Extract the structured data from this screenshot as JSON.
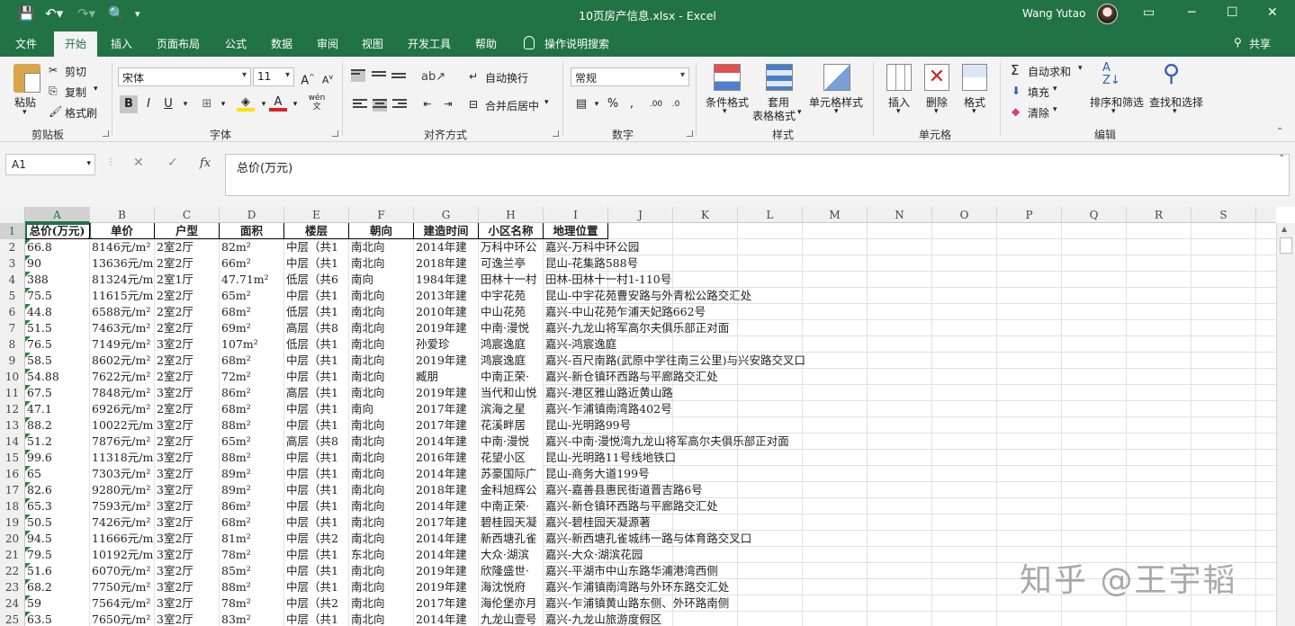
{
  "titlebar": {
    "doc_title": "10页房产信息.xlsx  -  Excel",
    "user_name": "Wang Yutao"
  },
  "tabs": [
    "文件",
    "开始",
    "插入",
    "页面布局",
    "公式",
    "数据",
    "审阅",
    "视图",
    "开发工具",
    "帮助"
  ],
  "active_tab": "开始",
  "tell_me": "操作说明搜索",
  "share": "共享",
  "ribbon": {
    "clipboard": {
      "paste": "粘贴",
      "cut": "剪切",
      "copy": "复制",
      "format_painter": "格式刷",
      "label": "剪贴板"
    },
    "font": {
      "name": "宋体",
      "size": "11",
      "label": "字体",
      "wen": "wén\n文"
    },
    "alignment": {
      "wrap": "自动换行",
      "merge": "合并后居中",
      "label": "对齐方式"
    },
    "number": {
      "format": "常规",
      "label": "数字"
    },
    "styles": {
      "conditional": "条件格式",
      "table1": "套用",
      "table2": "表格格式",
      "cell_styles": "单元格样式",
      "label": "样式"
    },
    "cells": {
      "insert": "插入",
      "delete": "删除",
      "format": "格式",
      "label": "单元格"
    },
    "editing": {
      "autosum": "自动求和",
      "fill": "填充",
      "clear": "清除",
      "sort": "排序和筛选",
      "find": "查找和选择",
      "label": "编辑"
    }
  },
  "formula_bar": {
    "name_box": "A1",
    "formula": "总价(万元)"
  },
  "columns": [
    "A",
    "B",
    "C",
    "D",
    "E",
    "F",
    "G",
    "H",
    "I",
    "J",
    "K",
    "L",
    "M",
    "N",
    "O",
    "P",
    "Q",
    "R",
    "S"
  ],
  "selected_cell": "A1",
  "sheet": {
    "headers": [
      "总价(万元)",
      "单价",
      "户型",
      "面积",
      "楼层",
      "朝向",
      "建造时间",
      "小区名称",
      "地理位置"
    ],
    "rows": [
      [
        "66.8",
        "8146元/m²",
        "2室2厅",
        "82m²",
        "中层（共1",
        "南北向",
        "2014年建",
        "万科中环公",
        "嘉兴-万科中环公园"
      ],
      [
        "90",
        "13636元/m²",
        "2室2厅",
        "66m²",
        "中层（共1",
        "南北向",
        "2018年建",
        "可逸兰亭",
        "昆山-花集路588号"
      ],
      [
        "388",
        "81324元/m²",
        "2室1厅",
        "47.71m²",
        "低层（共6",
        "南向",
        "1984年建",
        "田林十一村",
        "田林-田林十一村1-110号"
      ],
      [
        "75.5",
        "11615元/m²",
        "2室2厅",
        "65m²",
        "中层（共1",
        "南北向",
        "2013年建",
        "中宇花苑",
        "昆山-中宇花苑曹安路与外青松公路交汇处"
      ],
      [
        "44.8",
        "6588元/m²",
        "2室2厅",
        "68m²",
        "低层（共1",
        "南北向",
        "2010年建",
        "中山花苑",
        "嘉兴-中山花苑乍浦天妃路662号"
      ],
      [
        "51.5",
        "7463元/m²",
        "2室2厅",
        "69m²",
        "高层（共8",
        "南北向",
        "2019年建",
        "中南·漫悦",
        "嘉兴-九龙山将军高尔夫俱乐部正对面"
      ],
      [
        "76.5",
        "7149元/m²",
        "3室2厅",
        "107m²",
        "低层（共1",
        "南北向",
        "孙爱珍",
        "鸿宸逸庭",
        "嘉兴-鸿宸逸庭"
      ],
      [
        "58.5",
        "8602元/m²",
        "2室2厅",
        "68m²",
        "中层（共1",
        "南北向",
        "2019年建",
        "鸿宸逸庭",
        "嘉兴-百尺南路(武原中学往南三公里)与兴安路交叉口"
      ],
      [
        "54.88",
        "7622元/m²",
        "2室2厅",
        "72m²",
        "中层（共1",
        "南北向",
        "臧朋",
        "中南正荣·",
        "嘉兴-新仓镇环西路与平廊路交汇处"
      ],
      [
        "67.5",
        "7848元/m²",
        "3室2厅",
        "86m²",
        "高层（共1",
        "南北向",
        "2019年建",
        "当代和山悦",
        "嘉兴-港区雅山路近黄山路"
      ],
      [
        "47.1",
        "6926元/m²",
        "2室2厅",
        "68m²",
        "中层（共1",
        "南向",
        "2017年建",
        "滨海之星",
        "嘉兴-乍浦镇南湾路402号"
      ],
      [
        "88.2",
        "10022元/m²",
        "3室2厅",
        "88m²",
        "中层（共1",
        "南北向",
        "2017年建",
        "花溪畔居",
        "昆山-光明路99号"
      ],
      [
        "51.2",
        "7876元/m²",
        "2室2厅",
        "65m²",
        "高层（共8",
        "南北向",
        "2014年建",
        "中南·漫悦",
        "嘉兴-中南·漫悦湾九龙山将军高尔夫俱乐部正对面"
      ],
      [
        "99.6",
        "11318元/m²",
        "3室2厅",
        "88m²",
        "中层（共1",
        "南北向",
        "2016年建",
        "花望小区",
        "昆山-光明路11号线地铁口"
      ],
      [
        "65",
        "7303元/m²",
        "3室2厅",
        "89m²",
        "中层（共1",
        "南北向",
        "2014年建",
        "苏豪国际广",
        "昆山-商务大道199号"
      ],
      [
        "82.6",
        "9280元/m²",
        "3室2厅",
        "89m²",
        "中层（共1",
        "南北向",
        "2018年建",
        "金科旭辉公",
        "嘉兴-嘉善县惠民街道晋吉路6号"
      ],
      [
        "65.3",
        "7593元/m²",
        "3室2厅",
        "86m²",
        "中层（共1",
        "南北向",
        "2014年建",
        "中南正荣·",
        "嘉兴-新仓镇环西路与平廊路交汇处"
      ],
      [
        "50.5",
        "7426元/m²",
        "3室2厅",
        "68m²",
        "中层（共1",
        "南北向",
        "2017年建",
        "碧桂园天凝",
        "嘉兴-碧桂园天凝源著"
      ],
      [
        "94.5",
        "11666元/m²",
        "3室2厅",
        "81m²",
        "中层（共2",
        "南北向",
        "2014年建",
        "新西塘孔雀",
        "嘉兴-新西塘孔雀城纬一路与体育路交叉口"
      ],
      [
        "79.5",
        "10192元/m²",
        "3室2厅",
        "78m²",
        "中层（共1",
        "东北向",
        "2014年建",
        "大众·湖滨",
        "嘉兴-大众·湖滨花园"
      ],
      [
        "51.6",
        "6070元/m²",
        "3室2厅",
        "85m²",
        "中层（共1",
        "南北向",
        "2019年建",
        "欣隆盛世·",
        "嘉兴-平湖市中山东路华浦港湾西侧"
      ],
      [
        "68.2",
        "7750元/m²",
        "3室2厅",
        "88m²",
        "中层（共1",
        "南北向",
        "2019年建",
        "海沈悦府",
        "嘉兴-乍浦镇南湾路与外环东路交汇处"
      ],
      [
        "59",
        "7564元/m²",
        "3室2厅",
        "78m²",
        "中层（共2",
        "南北向",
        "2017年建",
        "海伦堡亦月",
        "嘉兴-乍浦镇黄山路东侧、外环路南侧"
      ],
      [
        "63.5",
        "7650元/m²",
        "3室2厅",
        "83m²",
        "中层（共1",
        "南北向",
        "2014年建",
        "九龙山壹号",
        "嘉兴-九龙山旅游度假区"
      ]
    ]
  },
  "watermark": "知乎 @王宇韬"
}
